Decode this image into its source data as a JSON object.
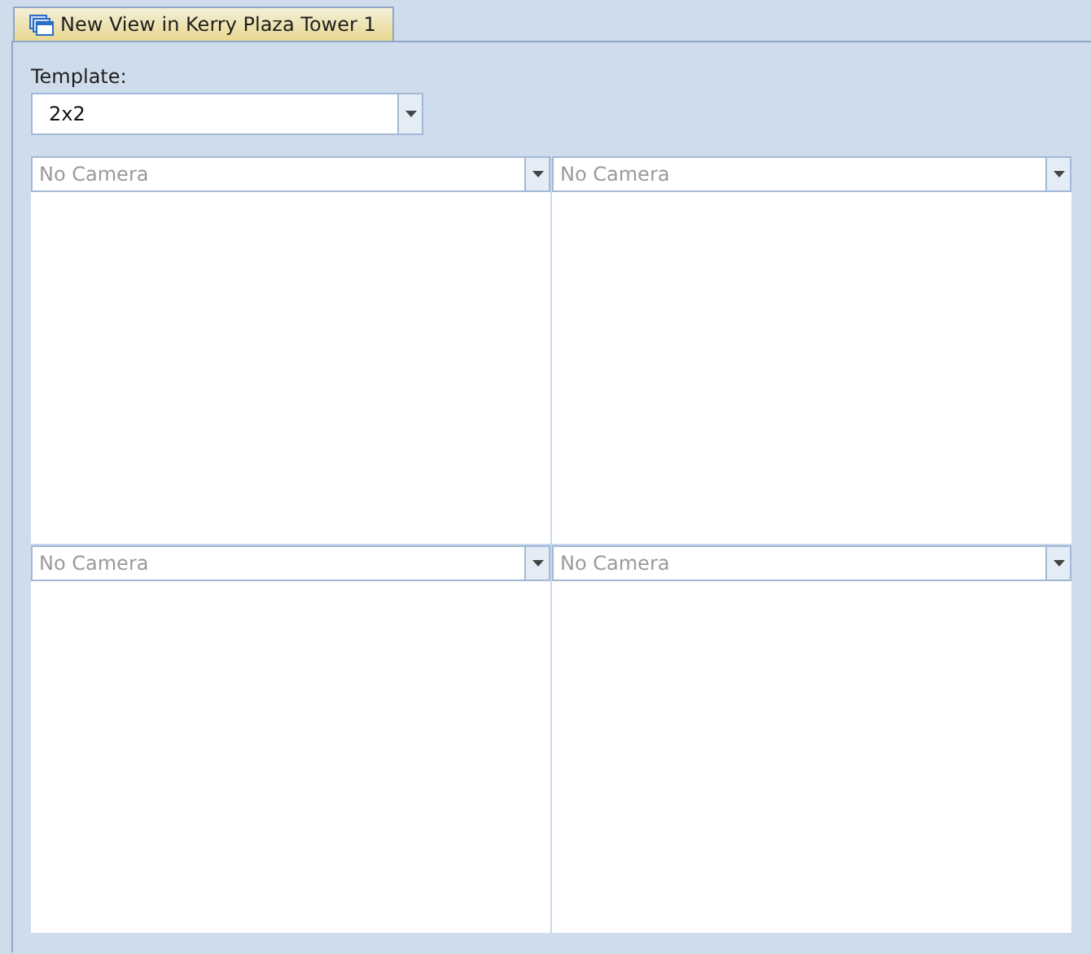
{
  "tab": {
    "title": "New View in Kerry Plaza Tower 1",
    "selected": true
  },
  "template": {
    "label": "Template:",
    "value": "2x2"
  },
  "views": [
    {
      "camera": {
        "placeholder": "No Camera"
      }
    },
    {
      "camera": {
        "placeholder": "No Camera"
      }
    },
    {
      "camera": {
        "placeholder": "No Camera"
      }
    },
    {
      "camera": {
        "placeholder": "No Camera"
      }
    }
  ]
}
